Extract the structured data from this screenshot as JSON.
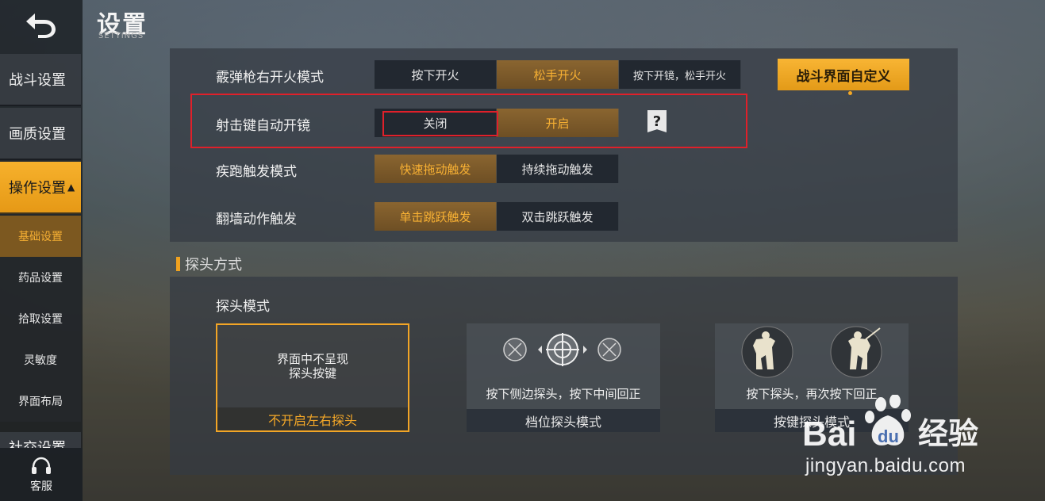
{
  "header": {
    "title": "设置",
    "subtitle": "SETTINGS"
  },
  "sidebar": {
    "main_items": [
      {
        "label": "战斗设置"
      },
      {
        "label": "画质设置"
      },
      {
        "label": "操作设置",
        "caret": "▲"
      }
    ],
    "sub_items": [
      {
        "label": "基础设置"
      },
      {
        "label": "药品设置"
      },
      {
        "label": "拾取设置"
      },
      {
        "label": "灵敏度"
      },
      {
        "label": "界面布局"
      }
    ],
    "partial_item": {
      "label": "社交设置"
    },
    "service": {
      "label": "客服"
    }
  },
  "settings": {
    "shotgun_fire": {
      "label": "霰弹枪右开火模式",
      "options": [
        "按下开火",
        "松手开火",
        "按下开镜，松手开火"
      ],
      "selected": 1
    },
    "auto_scope": {
      "label": "射击键自动开镜",
      "options": [
        "关闭",
        "开启"
      ],
      "selected": 1,
      "help": "?"
    },
    "sprint_trigger": {
      "label": "疾跑触发模式",
      "options": [
        "快速拖动触发",
        "持续拖动触发"
      ],
      "selected": 0
    },
    "vault_trigger": {
      "label": "翻墙动作触发",
      "options": [
        "单击跳跃触发",
        "双击跳跃触发"
      ],
      "selected": 0
    }
  },
  "customize_button": {
    "label": "战斗界面自定义"
  },
  "peek_section": {
    "title": "探头方式",
    "mode_label": "探头模式",
    "cards": [
      {
        "desc_lines": [
          "界面中不呈现",
          "探头按键"
        ],
        "name": "不开启左右探头",
        "selected": true
      },
      {
        "desc": "按下侧边探头，按下中间回正",
        "name": "档位探头模式",
        "selected": false
      },
      {
        "desc": "按下探头，再次按下回正",
        "name": "按键探头模式",
        "selected": false
      }
    ]
  },
  "watermark": {
    "brand": "Bai",
    "brand_suffix": "du",
    "product": "经验",
    "url": "jingyan.baidu.com"
  },
  "colors": {
    "accent": "#f7b033",
    "highlight_box": "#e0202a"
  }
}
